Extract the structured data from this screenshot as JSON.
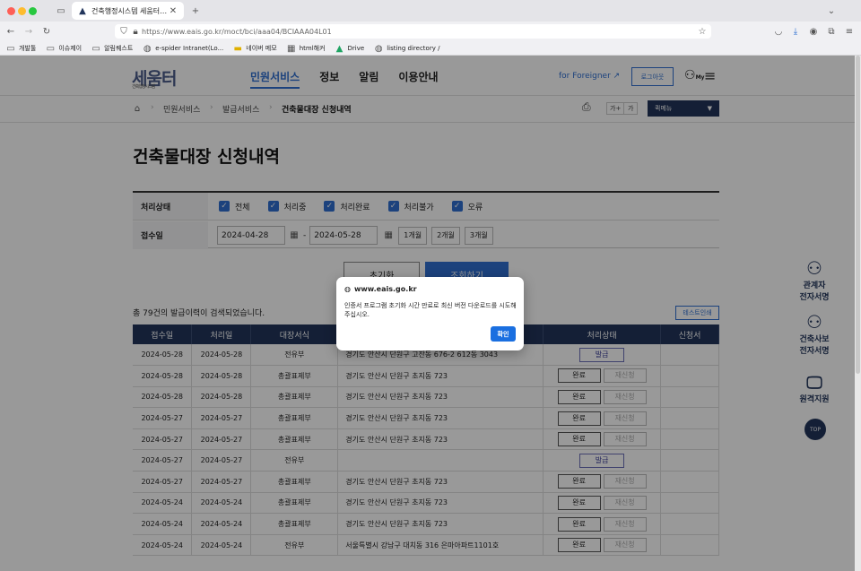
{
  "browser": {
    "tab_title": "건축행정시스템 세움터 - 민원서비스",
    "url": "https://www.eais.go.kr/moct/bci/aaa04/BCIAAA04L01",
    "bookmarks": [
      "개발툴",
      "이슈제이",
      "알림퀘스트",
      "e-spider Intranet(Lo...",
      "네이버 메모",
      "html해커",
      "Drive",
      "listing directory /"
    ]
  },
  "header": {
    "logo_text": "세움터",
    "logo_sub": "건축행정시스템",
    "nav": [
      "민원서비스",
      "정보",
      "알림",
      "이용안내"
    ],
    "foreigner": "for Foreigner",
    "logout": "로그아웃",
    "my": "My"
  },
  "breadcrumb": {
    "items": [
      "민원서비스",
      "발급서비스",
      "건축물대장 신청내역"
    ]
  },
  "font_controls": [
    "가+",
    "가"
  ],
  "quick_menu": "퀵메뉴",
  "page_title": "건축물대장 신청내역",
  "filter": {
    "status_label": "처리상태",
    "checkboxes": [
      "전체",
      "처리중",
      "처리완료",
      "처리불가",
      "오류"
    ],
    "date_label": "접수일",
    "date_from": "2024-04-28",
    "date_sep": "-",
    "date_to": "2024-05-28",
    "periods": [
      "1개월",
      "2개월",
      "3개월"
    ]
  },
  "buttons": {
    "reset": "초기화",
    "search": "조회하기",
    "test_print": "테스트인쇄"
  },
  "result_count": "총 79건의 발급이력이 검색되었습니다.",
  "table": {
    "headers": [
      "접수일",
      "처리일",
      "대장서식",
      "",
      "처리상태",
      "신청서"
    ],
    "rows": [
      {
        "recv": "2024-05-28",
        "proc": "2024-05-28",
        "form": "전유부",
        "addr": "경기도 안산시 단원구 고잔동 676-2 612동 3043",
        "status": "issue"
      },
      {
        "recv": "2024-05-28",
        "proc": "2024-05-28",
        "form": "총괄표제부",
        "addr": "경기도 안산시 단원구 초지동 723",
        "status": "done"
      },
      {
        "recv": "2024-05-28",
        "proc": "2024-05-28",
        "form": "총괄표제부",
        "addr": "경기도 안산시 단원구 초지동 723",
        "status": "done"
      },
      {
        "recv": "2024-05-27",
        "proc": "2024-05-27",
        "form": "총괄표제부",
        "addr": "경기도 안산시 단원구 초지동 723",
        "status": "done"
      },
      {
        "recv": "2024-05-27",
        "proc": "2024-05-27",
        "form": "총괄표제부",
        "addr": "경기도 안산시 단원구 초지동 723",
        "status": "done"
      },
      {
        "recv": "2024-05-27",
        "proc": "2024-05-27",
        "form": "전유부",
        "addr": "",
        "status": "issue"
      },
      {
        "recv": "2024-05-27",
        "proc": "2024-05-27",
        "form": "총괄표제부",
        "addr": "경기도 안산시 단원구 초지동 723",
        "status": "done"
      },
      {
        "recv": "2024-05-24",
        "proc": "2024-05-24",
        "form": "총괄표제부",
        "addr": "경기도 안산시 단원구 초지동 723",
        "status": "done"
      },
      {
        "recv": "2024-05-24",
        "proc": "2024-05-24",
        "form": "총괄표제부",
        "addr": "경기도 안산시 단원구 초지동 723",
        "status": "done"
      },
      {
        "recv": "2024-05-24",
        "proc": "2024-05-24",
        "form": "전유부",
        "addr": "서울특별시 강남구 대치동 316 은마아파트1101호",
        "status": "done"
      }
    ],
    "done_label": "완료",
    "reissue_label": "재신청",
    "issue_label": "발급"
  },
  "side": {
    "item1": [
      "관계자",
      "전자서명"
    ],
    "item2": [
      "건축사보",
      "전자서명"
    ],
    "item3": [
      "원격지원"
    ],
    "top": "TOP"
  },
  "dialog": {
    "host": "www.eais.go.kr",
    "message": "인증서 프로그램 초기화 시간 만료로 최신 버전 다운로드를 시도해주십시오.",
    "ok": "확인"
  },
  "colors": {
    "accent": "#2f6fd0",
    "navy": "#22355b",
    "dialog_ok": "#1a6fe0"
  }
}
